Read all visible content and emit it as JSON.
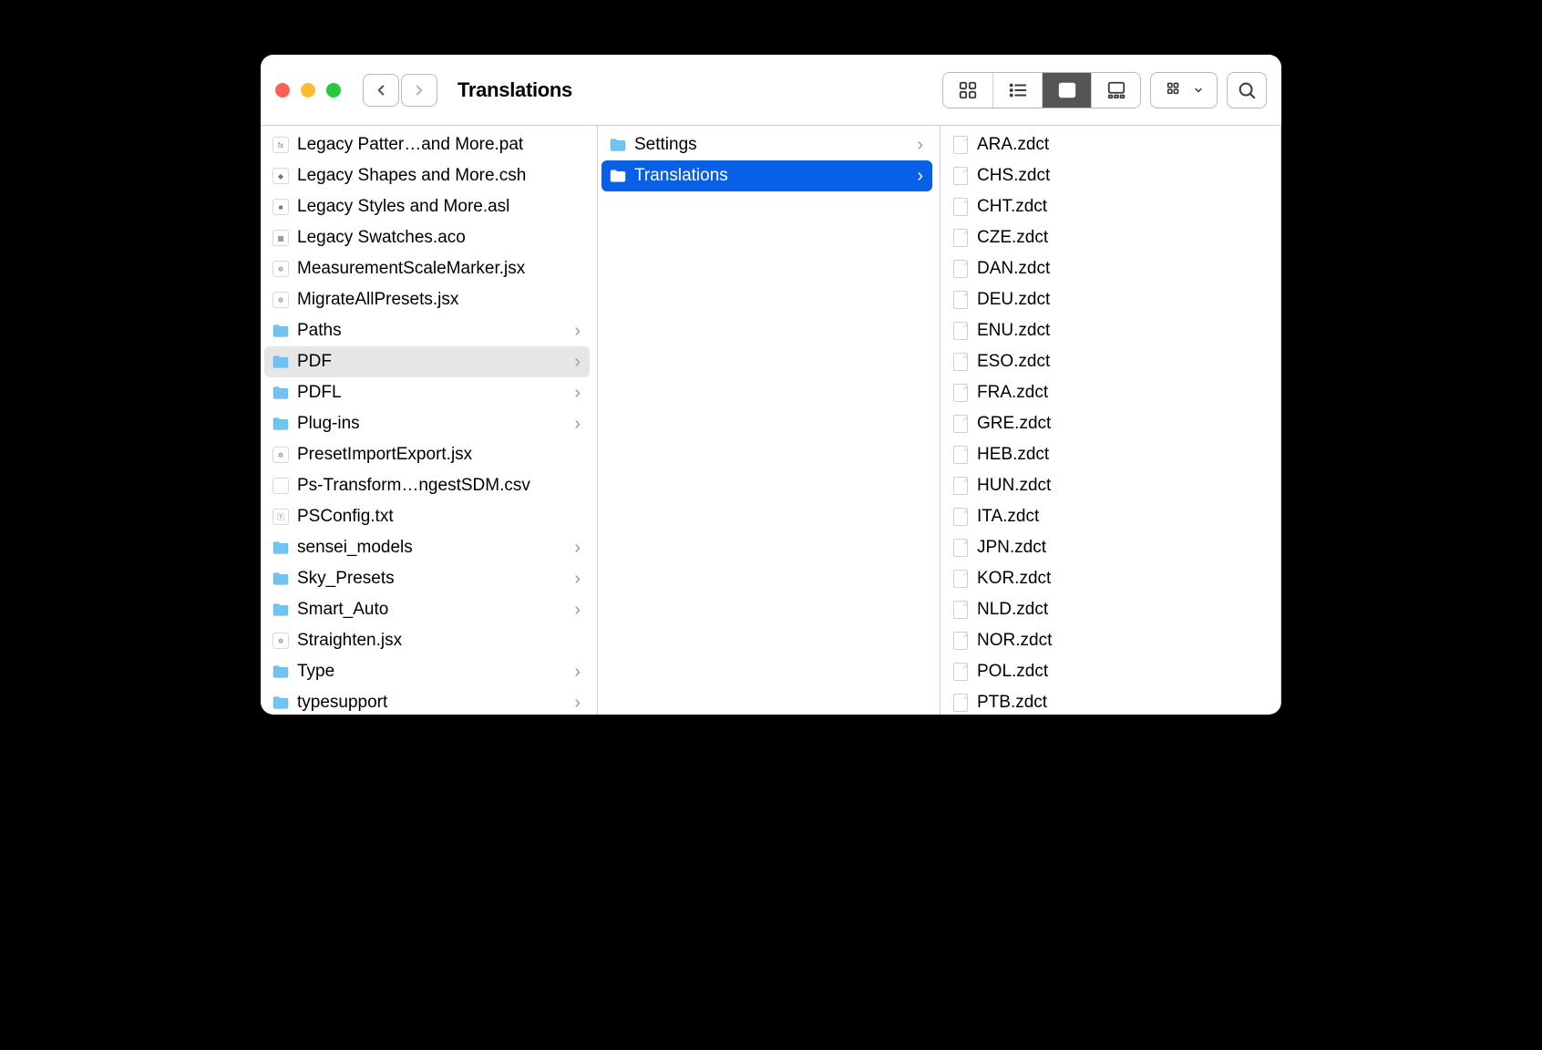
{
  "window": {
    "title": "Translations"
  },
  "column1": [
    {
      "name": "Legacy Patter…and More.pat",
      "type": "file",
      "glyph": "fx",
      "folder": false
    },
    {
      "name": "Legacy Shapes and More.csh",
      "type": "file",
      "glyph": "◆",
      "folder": false
    },
    {
      "name": "Legacy Styles and More.asl",
      "type": "file",
      "glyph": "■",
      "folder": false
    },
    {
      "name": "Legacy Swatches.aco",
      "type": "file",
      "glyph": "▦",
      "folder": false
    },
    {
      "name": "MeasurementScaleMarker.jsx",
      "type": "file",
      "glyph": "✲",
      "folder": false
    },
    {
      "name": "MigrateAllPresets.jsx",
      "type": "file",
      "glyph": "✲",
      "folder": false
    },
    {
      "name": "Paths",
      "type": "folder",
      "folder": true
    },
    {
      "name": "PDF",
      "type": "folder",
      "folder": true,
      "dimmed": true
    },
    {
      "name": "PDFL",
      "type": "folder",
      "folder": true
    },
    {
      "name": "Plug-ins",
      "type": "folder",
      "folder": true
    },
    {
      "name": "PresetImportExport.jsx",
      "type": "file",
      "glyph": "✲",
      "folder": false
    },
    {
      "name": "Ps-Transform…ngestSDM.csv",
      "type": "file",
      "glyph": " ",
      "folder": false
    },
    {
      "name": "PSConfig.txt",
      "type": "file",
      "glyph": "🅃",
      "folder": false
    },
    {
      "name": "sensei_models",
      "type": "folder",
      "folder": true
    },
    {
      "name": "Sky_Presets",
      "type": "folder",
      "folder": true
    },
    {
      "name": "Smart_Auto",
      "type": "folder",
      "folder": true
    },
    {
      "name": "Straighten.jsx",
      "type": "file",
      "glyph": "✲",
      "folder": false
    },
    {
      "name": "Type",
      "type": "folder",
      "folder": true
    },
    {
      "name": "typesupport",
      "type": "folder",
      "folder": true
    }
  ],
  "column2": [
    {
      "name": "Settings",
      "folder": true
    },
    {
      "name": "Translations",
      "folder": true,
      "selected": true
    }
  ],
  "column3": [
    {
      "name": "ARA.zdct"
    },
    {
      "name": "CHS.zdct"
    },
    {
      "name": "CHT.zdct"
    },
    {
      "name": "CZE.zdct"
    },
    {
      "name": "DAN.zdct"
    },
    {
      "name": "DEU.zdct"
    },
    {
      "name": "ENU.zdct"
    },
    {
      "name": "ESO.zdct"
    },
    {
      "name": "FRA.zdct"
    },
    {
      "name": "GRE.zdct"
    },
    {
      "name": "HEB.zdct"
    },
    {
      "name": "HUN.zdct"
    },
    {
      "name": "ITA.zdct"
    },
    {
      "name": "JPN.zdct"
    },
    {
      "name": "KOR.zdct"
    },
    {
      "name": "NLD.zdct"
    },
    {
      "name": "NOR.zdct"
    },
    {
      "name": "POL.zdct"
    },
    {
      "name": "PTB.zdct"
    }
  ]
}
